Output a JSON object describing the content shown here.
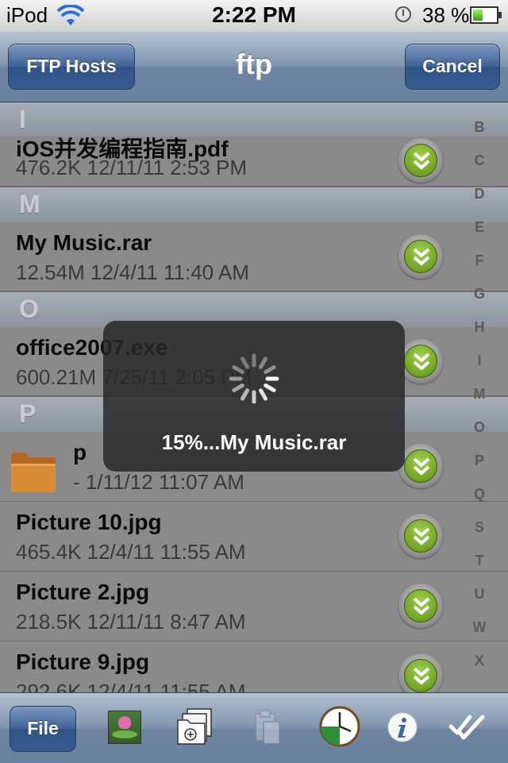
{
  "status_bar": {
    "carrier": "iPod",
    "time": "2:22 PM",
    "battery_pct": "38 %",
    "icons": [
      "wifi-icon",
      "clock-icon",
      "battery-icon"
    ]
  },
  "nav": {
    "left_button": "FTP Hosts",
    "title": "ftp",
    "right_button": "Cancel"
  },
  "list": {
    "sections": {
      "i": "I",
      "m": "M",
      "o": "O",
      "p": "P"
    },
    "rows": [
      {
        "name": "iOS并发编程指南.pdf",
        "meta": "476.2K 12/11/11 2:53 PM"
      },
      {
        "name": "My Music.rar",
        "meta": "12.54M 12/4/11 11:40 AM"
      },
      {
        "name": "office2007.exe",
        "meta": "600.21M 7/25/11 2:05 PM"
      },
      {
        "name": "p",
        "meta": "- 1/11/12 11:07 AM"
      },
      {
        "name": "Picture 10.jpg",
        "meta": "465.4K 12/4/11 11:55 AM"
      },
      {
        "name": "Picture 2.jpg",
        "meta": "218.5K 12/11/11 8:47 AM"
      },
      {
        "name": "Picture 9.jpg",
        "meta": "292.6K 12/4/11 11:55 AM"
      }
    ]
  },
  "index": [
    "B",
    "C",
    "D",
    "E",
    "F",
    "G",
    "H",
    "I",
    "M",
    "O",
    "P",
    "Q",
    "S",
    "T",
    "U",
    "W",
    "X"
  ],
  "hud": {
    "message": "15%...My Music.rar",
    "progress_percent": 15
  },
  "toolbar": {
    "file_button": "File",
    "icons": [
      "photo-icon",
      "new-folder-icon",
      "paste-icon",
      "clock-icon",
      "info-icon",
      "checkmark-icon"
    ]
  },
  "colors": {
    "nav_blue": "#385b91",
    "download_green": "#7cb82f"
  }
}
